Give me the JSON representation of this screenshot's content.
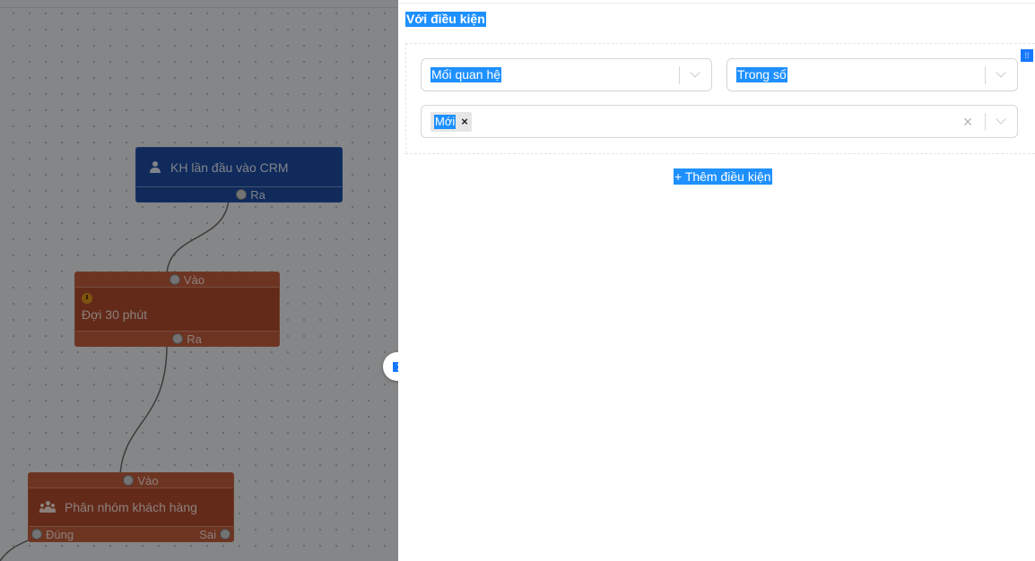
{
  "canvas": {
    "nodes": {
      "start": {
        "label": "KH lần đầu vào CRM",
        "out_port": "Ra",
        "icon": "user-icon",
        "color": "#1d4ea6"
      },
      "wait": {
        "in_port": "Vào",
        "label": "Đợi 30 phút",
        "out_port": "Ra",
        "icon": "clock-icon",
        "color": "#b54d31"
      },
      "group": {
        "in_port": "Vào",
        "label": "Phân nhóm khách hàng",
        "true_port": "Đúng",
        "false_port": "Sai",
        "icon": "users-icon",
        "color": "#b54d31"
      }
    }
  },
  "panel": {
    "section_title": "Với điều kiện",
    "relation_select": {
      "value": "Mối quan hệ"
    },
    "weight_select": {
      "value": "Trong số"
    },
    "values_select": {
      "tags": [
        "Mới"
      ]
    },
    "add_condition_label": "+ Thêm điều kiện",
    "accent_color": "#1677ff",
    "selection_color": "#1e90ff"
  }
}
